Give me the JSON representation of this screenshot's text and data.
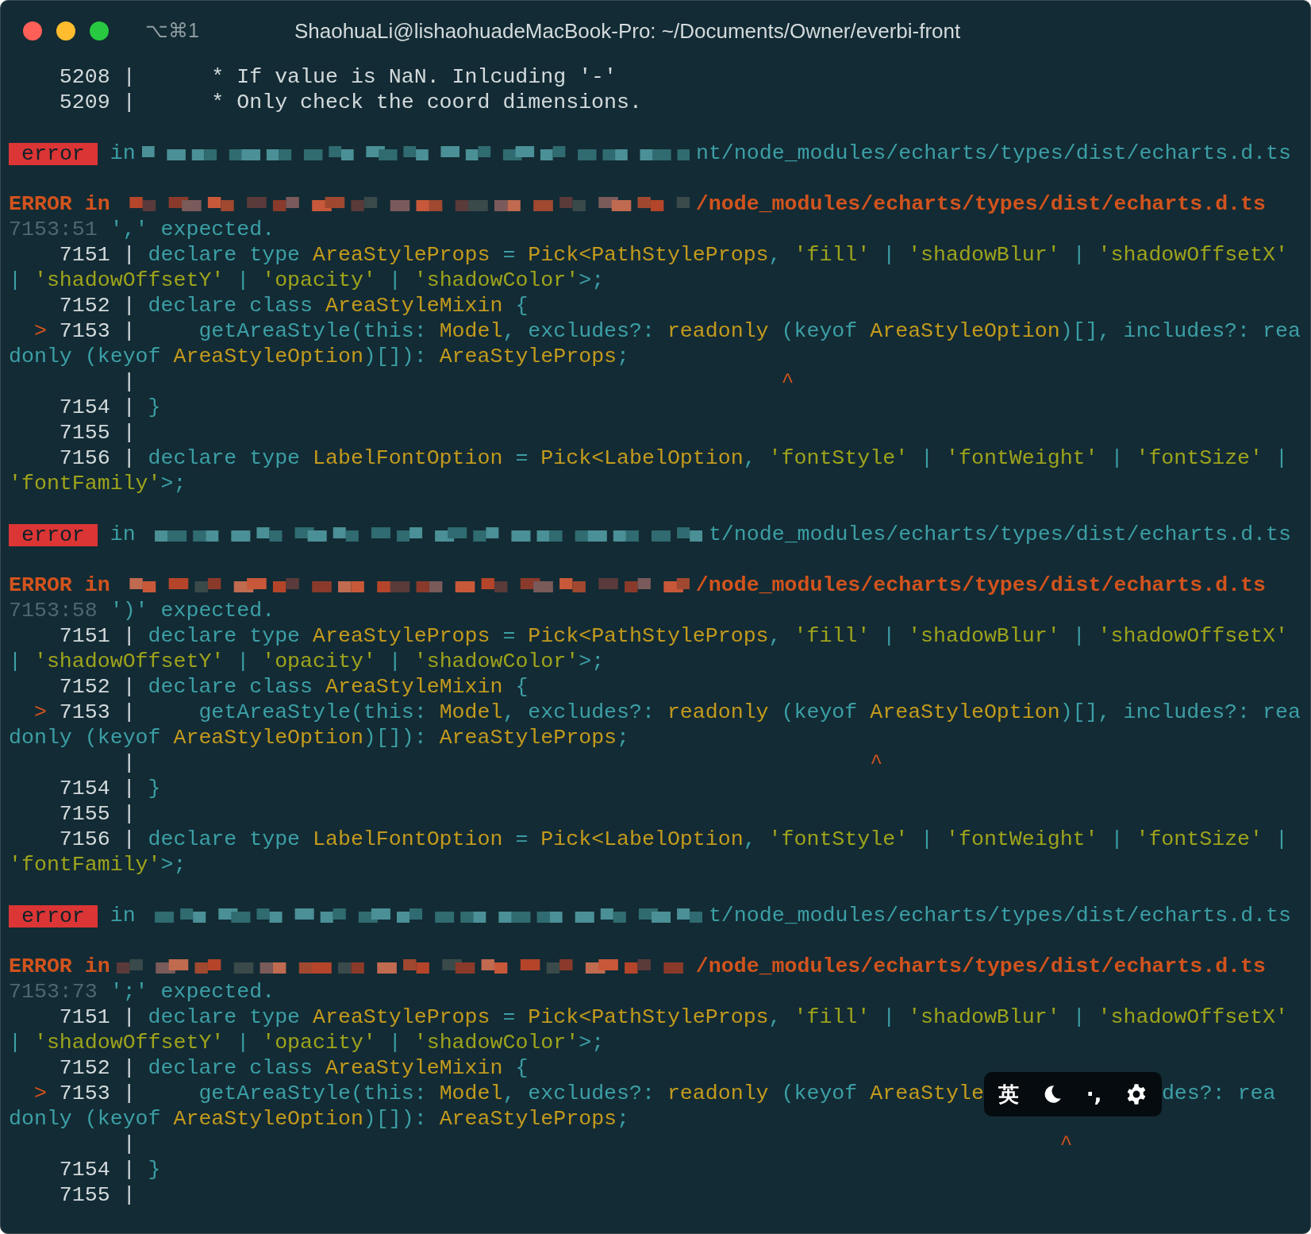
{
  "window": {
    "title": "ShaohuaLi@lishaohuadeMacBook-Pro: ~/Documents/Owner/everbi-front",
    "shortcut": "⌥⌘1"
  },
  "lines": [
    {
      "kind": "code",
      "segments": [
        {
          "kind": "line_number",
          "text": "    5208 |      * If value is NaN. Inlcuding '-'"
        }
      ]
    },
    {
      "kind": "code",
      "segments": [
        {
          "kind": "line_number",
          "text": "    5209 |      * Only check the coord dimensions."
        }
      ]
    },
    {
      "kind": "blank"
    },
    {
      "kind": "error_badge",
      "badge": "error",
      "word": "in",
      "path": "nt/node_modules/echarts/types/dist/echarts.d.ts"
    },
    {
      "kind": "blank"
    },
    {
      "kind": "error_heading",
      "word": "ERROR in",
      "path": "/node_modules/echarts/types/dist/echarts.d.ts"
    },
    {
      "kind": "code",
      "segments": [
        {
          "kind": "position",
          "text": "7153:51"
        },
        {
          "kind": "keyword",
          "text": " ',' expected."
        }
      ]
    },
    {
      "kind": "code",
      "segments": [
        {
          "kind": "line_number",
          "text": "    7151 | "
        },
        {
          "kind": "keyword",
          "text": "declare type "
        },
        {
          "kind": "type",
          "text": "AreaStyleProps"
        },
        {
          "kind": "keyword",
          "text": " = "
        },
        {
          "kind": "type",
          "text": "Pick<PathStyleProps"
        },
        {
          "kind": "keyword",
          "text": ", "
        },
        {
          "kind": "string",
          "text": "'fill'"
        },
        {
          "kind": "keyword",
          "text": " | "
        },
        {
          "kind": "string",
          "text": "'shadowBlur'"
        },
        {
          "kind": "keyword",
          "text": " | "
        },
        {
          "kind": "string",
          "text": "'shadowOffsetX'"
        }
      ]
    },
    {
      "kind": "code",
      "segments": [
        {
          "kind": "keyword",
          "text": "| "
        },
        {
          "kind": "string",
          "text": "'shadowOffsetY'"
        },
        {
          "kind": "keyword",
          "text": " | "
        },
        {
          "kind": "string",
          "text": "'opacity'"
        },
        {
          "kind": "keyword",
          "text": " | "
        },
        {
          "kind": "string",
          "text": "'shadowColor'"
        },
        {
          "kind": "keyword",
          "text": ">;"
        }
      ]
    },
    {
      "kind": "code",
      "segments": [
        {
          "kind": "line_number",
          "text": "    7152 | "
        },
        {
          "kind": "keyword",
          "text": "declare class "
        },
        {
          "kind": "type",
          "text": "AreaStyleMixin"
        },
        {
          "kind": "keyword",
          "text": " {"
        }
      ]
    },
    {
      "kind": "code",
      "segments": [
        {
          "kind": "marker",
          "text": "  > "
        },
        {
          "kind": "line_number",
          "text": "7153 | "
        },
        {
          "kind": "keyword",
          "text": "    getAreaStyle(this: "
        },
        {
          "kind": "type",
          "text": "Model"
        },
        {
          "kind": "keyword",
          "text": ", excludes?: "
        },
        {
          "kind": "type",
          "text": "readonly "
        },
        {
          "kind": "keyword",
          "text": "(keyof "
        },
        {
          "kind": "type",
          "text": "AreaStyleOption"
        },
        {
          "kind": "keyword",
          "text": ")[], includes?: rea"
        }
      ]
    },
    {
      "kind": "code",
      "segments": [
        {
          "kind": "keyword",
          "text": "donly (keyof "
        },
        {
          "kind": "type",
          "text": "AreaStyleOption"
        },
        {
          "kind": "keyword",
          "text": ")[]): "
        },
        {
          "kind": "type",
          "text": "AreaStyleProps"
        },
        {
          "kind": "keyword",
          "text": ";"
        }
      ]
    },
    {
      "kind": "code",
      "segments": [
        {
          "kind": "line_number",
          "text": "         |"
        },
        {
          "kind": "caret",
          "text": "                                                   ^"
        }
      ]
    },
    {
      "kind": "code",
      "segments": [
        {
          "kind": "line_number",
          "text": "    7154 | "
        },
        {
          "kind": "keyword",
          "text": "}"
        }
      ]
    },
    {
      "kind": "code",
      "segments": [
        {
          "kind": "line_number",
          "text": "    7155 |"
        }
      ]
    },
    {
      "kind": "code",
      "segments": [
        {
          "kind": "line_number",
          "text": "    7156 | "
        },
        {
          "kind": "keyword",
          "text": "declare type "
        },
        {
          "kind": "type",
          "text": "LabelFontOption"
        },
        {
          "kind": "keyword",
          "text": " = "
        },
        {
          "kind": "type",
          "text": "Pick<LabelOption"
        },
        {
          "kind": "keyword",
          "text": ", "
        },
        {
          "kind": "string",
          "text": "'fontStyle'"
        },
        {
          "kind": "keyword",
          "text": " | "
        },
        {
          "kind": "string",
          "text": "'fontWeight'"
        },
        {
          "kind": "keyword",
          "text": " | "
        },
        {
          "kind": "string",
          "text": "'fontSize'"
        },
        {
          "kind": "keyword",
          "text": " |"
        }
      ]
    },
    {
      "kind": "code",
      "segments": [
        {
          "kind": "string",
          "text": "'fontFamily'"
        },
        {
          "kind": "keyword",
          "text": ">;"
        }
      ]
    },
    {
      "kind": "blank"
    },
    {
      "kind": "error_badge",
      "badge": "error",
      "word": "in",
      "path": "t/node_modules/echarts/types/dist/echarts.d.ts"
    },
    {
      "kind": "blank"
    },
    {
      "kind": "error_heading",
      "word": "ERROR in",
      "path": "/node_modules/echarts/types/dist/echarts.d.ts"
    },
    {
      "kind": "code",
      "segments": [
        {
          "kind": "position",
          "text": "7153:58"
        },
        {
          "kind": "keyword",
          "text": " ')' expected."
        }
      ]
    },
    {
      "kind": "code",
      "segments": [
        {
          "kind": "line_number",
          "text": "    7151 | "
        },
        {
          "kind": "keyword",
          "text": "declare type "
        },
        {
          "kind": "type",
          "text": "AreaStyleProps"
        },
        {
          "kind": "keyword",
          "text": " = "
        },
        {
          "kind": "type",
          "text": "Pick<PathStyleProps"
        },
        {
          "kind": "keyword",
          "text": ", "
        },
        {
          "kind": "string",
          "text": "'fill'"
        },
        {
          "kind": "keyword",
          "text": " | "
        },
        {
          "kind": "string",
          "text": "'shadowBlur'"
        },
        {
          "kind": "keyword",
          "text": " | "
        },
        {
          "kind": "string",
          "text": "'shadowOffsetX'"
        }
      ]
    },
    {
      "kind": "code",
      "segments": [
        {
          "kind": "keyword",
          "text": "| "
        },
        {
          "kind": "string",
          "text": "'shadowOffsetY'"
        },
        {
          "kind": "keyword",
          "text": " | "
        },
        {
          "kind": "string",
          "text": "'opacity'"
        },
        {
          "kind": "keyword",
          "text": " | "
        },
        {
          "kind": "string",
          "text": "'shadowColor'"
        },
        {
          "kind": "keyword",
          "text": ">;"
        }
      ]
    },
    {
      "kind": "code",
      "segments": [
        {
          "kind": "line_number",
          "text": "    7152 | "
        },
        {
          "kind": "keyword",
          "text": "declare class "
        },
        {
          "kind": "type",
          "text": "AreaStyleMixin"
        },
        {
          "kind": "keyword",
          "text": " {"
        }
      ]
    },
    {
      "kind": "code",
      "segments": [
        {
          "kind": "marker",
          "text": "  > "
        },
        {
          "kind": "line_number",
          "text": "7153 | "
        },
        {
          "kind": "keyword",
          "text": "    getAreaStyle(this: "
        },
        {
          "kind": "type",
          "text": "Model"
        },
        {
          "kind": "keyword",
          "text": ", excludes?: "
        },
        {
          "kind": "type",
          "text": "readonly "
        },
        {
          "kind": "keyword",
          "text": "(keyof "
        },
        {
          "kind": "type",
          "text": "AreaStyleOption"
        },
        {
          "kind": "keyword",
          "text": ")[], includes?: rea"
        }
      ]
    },
    {
      "kind": "code",
      "segments": [
        {
          "kind": "keyword",
          "text": "donly (keyof "
        },
        {
          "kind": "type",
          "text": "AreaStyleOption"
        },
        {
          "kind": "keyword",
          "text": ")[]): "
        },
        {
          "kind": "type",
          "text": "AreaStyleProps"
        },
        {
          "kind": "keyword",
          "text": ";"
        }
      ]
    },
    {
      "kind": "code",
      "segments": [
        {
          "kind": "line_number",
          "text": "         |"
        },
        {
          "kind": "caret",
          "text": "                                                          ^"
        }
      ]
    },
    {
      "kind": "code",
      "segments": [
        {
          "kind": "line_number",
          "text": "    7154 | "
        },
        {
          "kind": "keyword",
          "text": "}"
        }
      ]
    },
    {
      "kind": "code",
      "segments": [
        {
          "kind": "line_number",
          "text": "    7155 |"
        }
      ]
    },
    {
      "kind": "code",
      "segments": [
        {
          "kind": "line_number",
          "text": "    7156 | "
        },
        {
          "kind": "keyword",
          "text": "declare type "
        },
        {
          "kind": "type",
          "text": "LabelFontOption"
        },
        {
          "kind": "keyword",
          "text": " = "
        },
        {
          "kind": "type",
          "text": "Pick<LabelOption"
        },
        {
          "kind": "keyword",
          "text": ", "
        },
        {
          "kind": "string",
          "text": "'fontStyle'"
        },
        {
          "kind": "keyword",
          "text": " | "
        },
        {
          "kind": "string",
          "text": "'fontWeight'"
        },
        {
          "kind": "keyword",
          "text": " | "
        },
        {
          "kind": "string",
          "text": "'fontSize'"
        },
        {
          "kind": "keyword",
          "text": " |"
        }
      ]
    },
    {
      "kind": "code",
      "segments": [
        {
          "kind": "string",
          "text": "'fontFamily'"
        },
        {
          "kind": "keyword",
          "text": ">;"
        }
      ]
    },
    {
      "kind": "blank"
    },
    {
      "kind": "error_badge",
      "badge": "error",
      "word": "in",
      "path": "t/node_modules/echarts/types/dist/echarts.d.ts"
    },
    {
      "kind": "blank"
    },
    {
      "kind": "error_heading",
      "word": "ERROR in",
      "path": "/node_modules/echarts/types/dist/echarts.d.ts"
    },
    {
      "kind": "code",
      "segments": [
        {
          "kind": "position",
          "text": "7153:73"
        },
        {
          "kind": "keyword",
          "text": " ';' expected."
        }
      ]
    },
    {
      "kind": "code",
      "segments": [
        {
          "kind": "line_number",
          "text": "    7151 | "
        },
        {
          "kind": "keyword",
          "text": "declare type "
        },
        {
          "kind": "type",
          "text": "AreaStyleProps"
        },
        {
          "kind": "keyword",
          "text": " = "
        },
        {
          "kind": "type",
          "text": "Pick<PathStyleProps"
        },
        {
          "kind": "keyword",
          "text": ", "
        },
        {
          "kind": "string",
          "text": "'fill'"
        },
        {
          "kind": "keyword",
          "text": " | "
        },
        {
          "kind": "string",
          "text": "'shadowBlur'"
        },
        {
          "kind": "keyword",
          "text": " | "
        },
        {
          "kind": "string",
          "text": "'shadowOffsetX'"
        }
      ]
    },
    {
      "kind": "code",
      "segments": [
        {
          "kind": "keyword",
          "text": "| "
        },
        {
          "kind": "string",
          "text": "'shadowOffsetY'"
        },
        {
          "kind": "keyword",
          "text": " | "
        },
        {
          "kind": "string",
          "text": "'opacity'"
        },
        {
          "kind": "keyword",
          "text": " | "
        },
        {
          "kind": "string",
          "text": "'shadowColor'"
        },
        {
          "kind": "keyword",
          "text": ">;"
        }
      ]
    },
    {
      "kind": "code",
      "segments": [
        {
          "kind": "line_number",
          "text": "    7152 | "
        },
        {
          "kind": "keyword",
          "text": "declare class "
        },
        {
          "kind": "type",
          "text": "AreaStyleMixin"
        },
        {
          "kind": "keyword",
          "text": " {"
        }
      ]
    },
    {
      "kind": "code_with_toolbar",
      "segments": [
        {
          "kind": "marker",
          "text": "  > "
        },
        {
          "kind": "line_number",
          "text": "7153 | "
        },
        {
          "kind": "keyword",
          "text": "    getAreaStyle(this: "
        },
        {
          "kind": "type",
          "text": "Model"
        },
        {
          "kind": "keyword",
          "text": ", excludes?: "
        },
        {
          "kind": "type",
          "text": "readonly "
        },
        {
          "kind": "keyword",
          "text": "(keyof "
        },
        {
          "kind": "type",
          "text": "AreaStyle"
        }
      ],
      "after": [
        {
          "kind": "keyword",
          "text": "des?: rea"
        }
      ]
    },
    {
      "kind": "code",
      "segments": [
        {
          "kind": "keyword",
          "text": "donly (keyof "
        },
        {
          "kind": "type",
          "text": "AreaStyleOption"
        },
        {
          "kind": "keyword",
          "text": ")[]): "
        },
        {
          "kind": "type",
          "text": "AreaStyleProps"
        },
        {
          "kind": "keyword",
          "text": ";"
        }
      ]
    },
    {
      "kind": "code",
      "segments": [
        {
          "kind": "line_number",
          "text": "         |"
        },
        {
          "kind": "caret",
          "text": "                                                                         ^"
        }
      ]
    },
    {
      "kind": "code",
      "segments": [
        {
          "kind": "line_number",
          "text": "    7154 | "
        },
        {
          "kind": "keyword",
          "text": "}"
        }
      ]
    },
    {
      "kind": "code",
      "segments": [
        {
          "kind": "line_number",
          "text": "    7155 |"
        }
      ]
    }
  ],
  "ime_toolbar": {
    "mode": "英",
    "punctuation": "·,"
  }
}
